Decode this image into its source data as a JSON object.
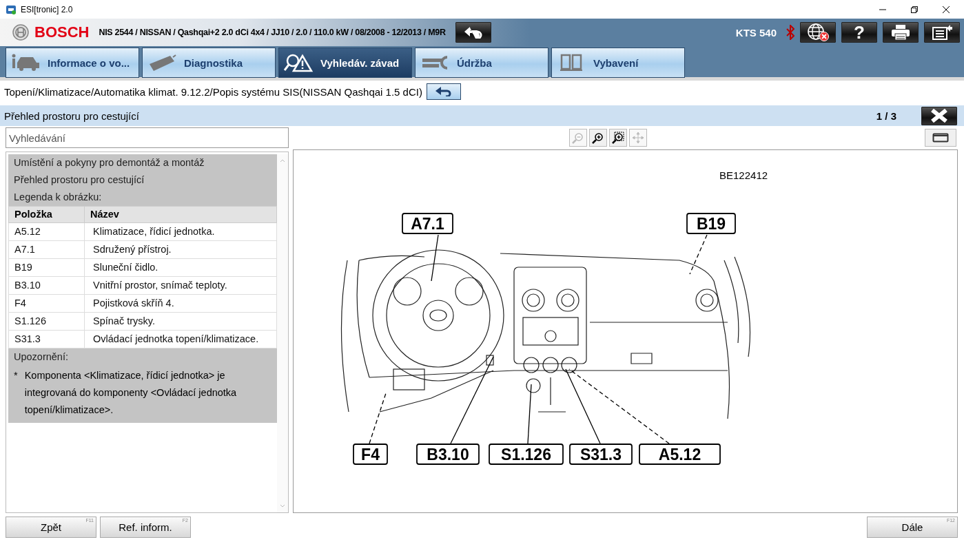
{
  "window": {
    "title": "ESI[tronic] 2.0"
  },
  "header": {
    "brand": "BOSCH",
    "vehicle": "NIS 2544 / NISSAN / Qashqai+2 2.0 dCi 4x4 / JJ10 / 2.0 / 110.0 kW / 08/2008 - 12/2013 / M9R",
    "device": "KTS 540",
    "help": "?"
  },
  "tabs": [
    {
      "label": "Informace o vo...",
      "selected": false
    },
    {
      "label": "Diagnostika",
      "selected": false
    },
    {
      "label": "Vyhledáv. závad",
      "selected": true
    },
    {
      "label": "Údržba",
      "selected": false
    },
    {
      "label": "Vybavení",
      "selected": false
    }
  ],
  "breadcrumb": "Topení/Klimatizace/Automatika klimat. 9.12.2/Popis systému SIS(NISSAN Qashqai 1.5 dCI)",
  "section": {
    "title": "Přehled prostoru pro cestující",
    "page": "1 / 3"
  },
  "search": {
    "placeholder": "Vyhledávání"
  },
  "document": {
    "headings": [
      "Umístění a pokyny pro demontáž a montáž",
      "Přehled prostoru pro cestující",
      "Legenda k obrázku:"
    ],
    "columns": [
      "Položka",
      "Název"
    ],
    "rows": [
      [
        "A5.12",
        "Klimatizace, řídicí jednotka."
      ],
      [
        "A7.1",
        "Sdružený přístroj."
      ],
      [
        "B19",
        "Sluneční čidlo."
      ],
      [
        "B3.10",
        "Vnitřní prostor, snímač teploty."
      ],
      [
        "F4",
        "Pojistková skříň 4."
      ],
      [
        "S1.126",
        "Spínač trysky."
      ],
      [
        "S31.3",
        "Ovládací jednotka topení/klimatizace."
      ]
    ],
    "note_title": "Upozornění:",
    "note_bullet": "*",
    "note_text": "Komponenta <Klimatizace, řídicí jednotka> je integrovaná do komponenty <Ovládací jednotka topení/klimatizace>."
  },
  "zoom_tools": [
    {
      "disabled": true
    },
    {
      "disabled": false
    },
    {
      "disabled": false
    },
    {
      "disabled": true
    }
  ],
  "figure": {
    "code": "BE122412",
    "callouts": [
      "A7.1",
      "B19",
      "F4",
      "B3.10",
      "S1.126",
      "S31.3",
      "A5.12"
    ]
  },
  "footer": {
    "left_buttons": [
      {
        "label": "Zpět",
        "key": "F11"
      },
      {
        "label": "Ref. inform.",
        "key": "F2"
      }
    ],
    "right_button": {
      "label": "Dále",
      "key": "F12"
    }
  }
}
